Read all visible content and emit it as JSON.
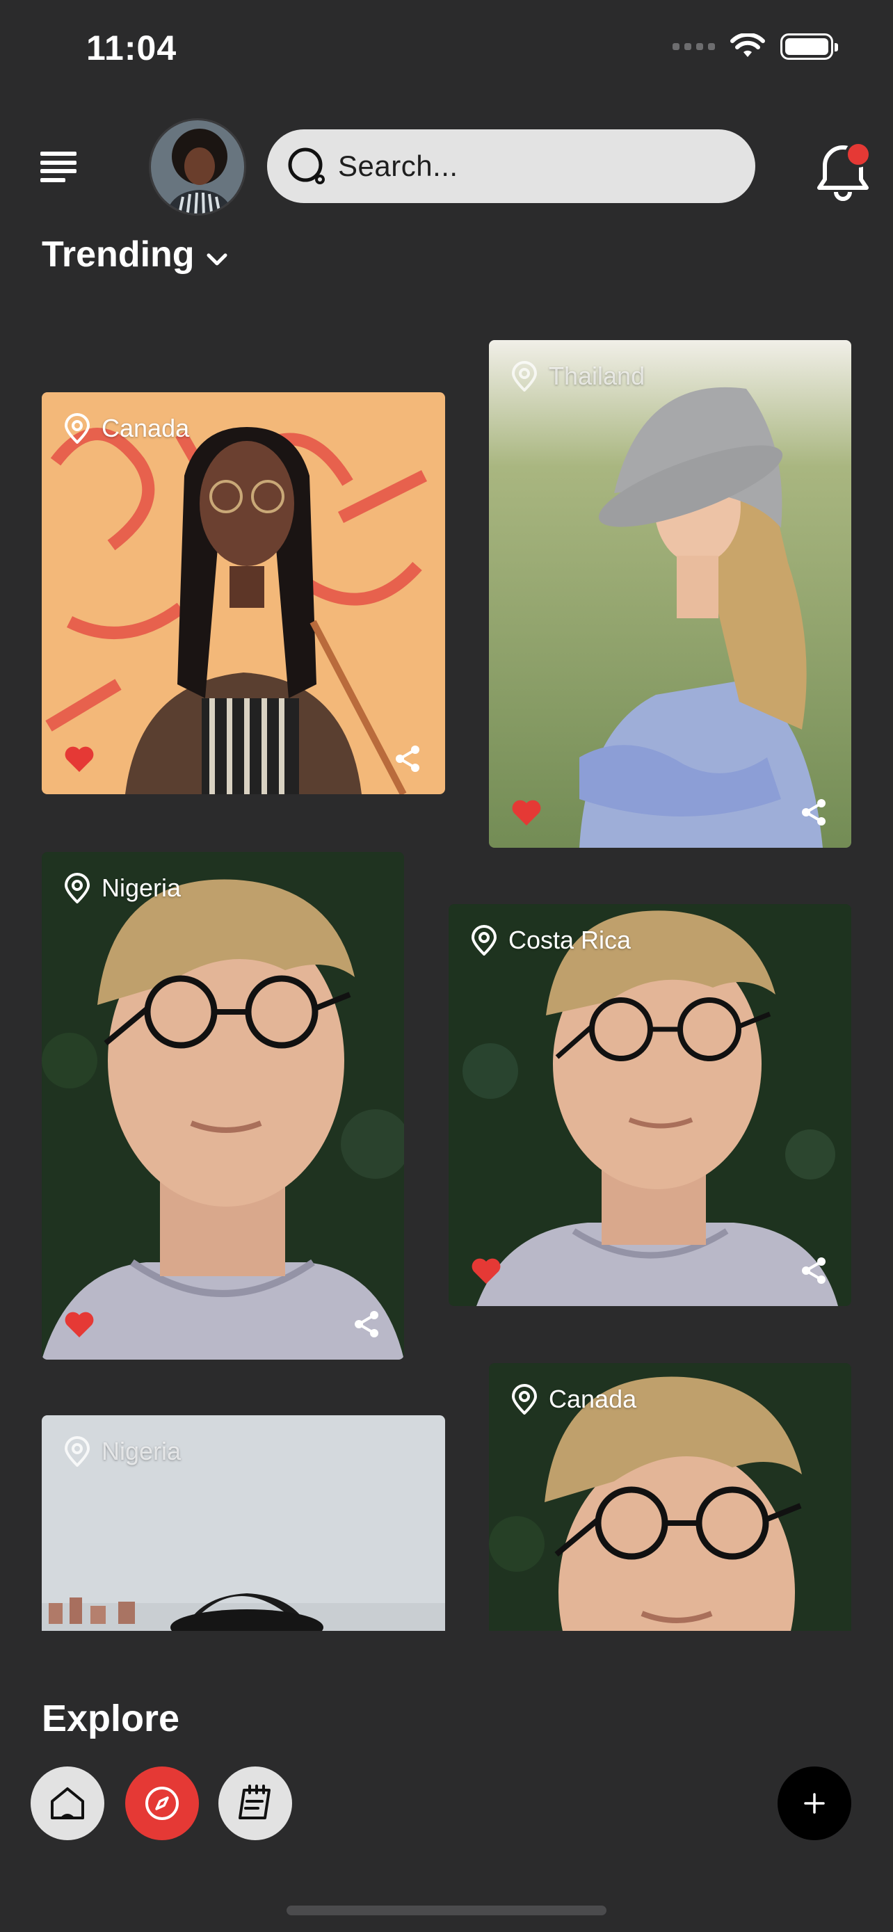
{
  "status_bar": {
    "time": "11:04"
  },
  "header": {
    "search_placeholder": "Search..."
  },
  "section": {
    "title": "Trending"
  },
  "cards": [
    {
      "location": "Canada"
    },
    {
      "location": "Thailand"
    },
    {
      "location": "Nigeria"
    },
    {
      "location": "Costa Rica"
    },
    {
      "location": "Nigeria"
    },
    {
      "location": "Canada"
    }
  ],
  "footer": {
    "title": "Explore"
  },
  "icons": [
    "menu-icon",
    "search-icon",
    "bell-icon",
    "chevron-down-icon",
    "location-pin-icon",
    "heart-icon",
    "share-icon",
    "home-icon",
    "compass-icon",
    "notepad-icon",
    "plus-icon"
  ],
  "colors": {
    "background": "#2b2b2c",
    "accent": "#e53935",
    "search_bg": "#e3e3e3"
  }
}
